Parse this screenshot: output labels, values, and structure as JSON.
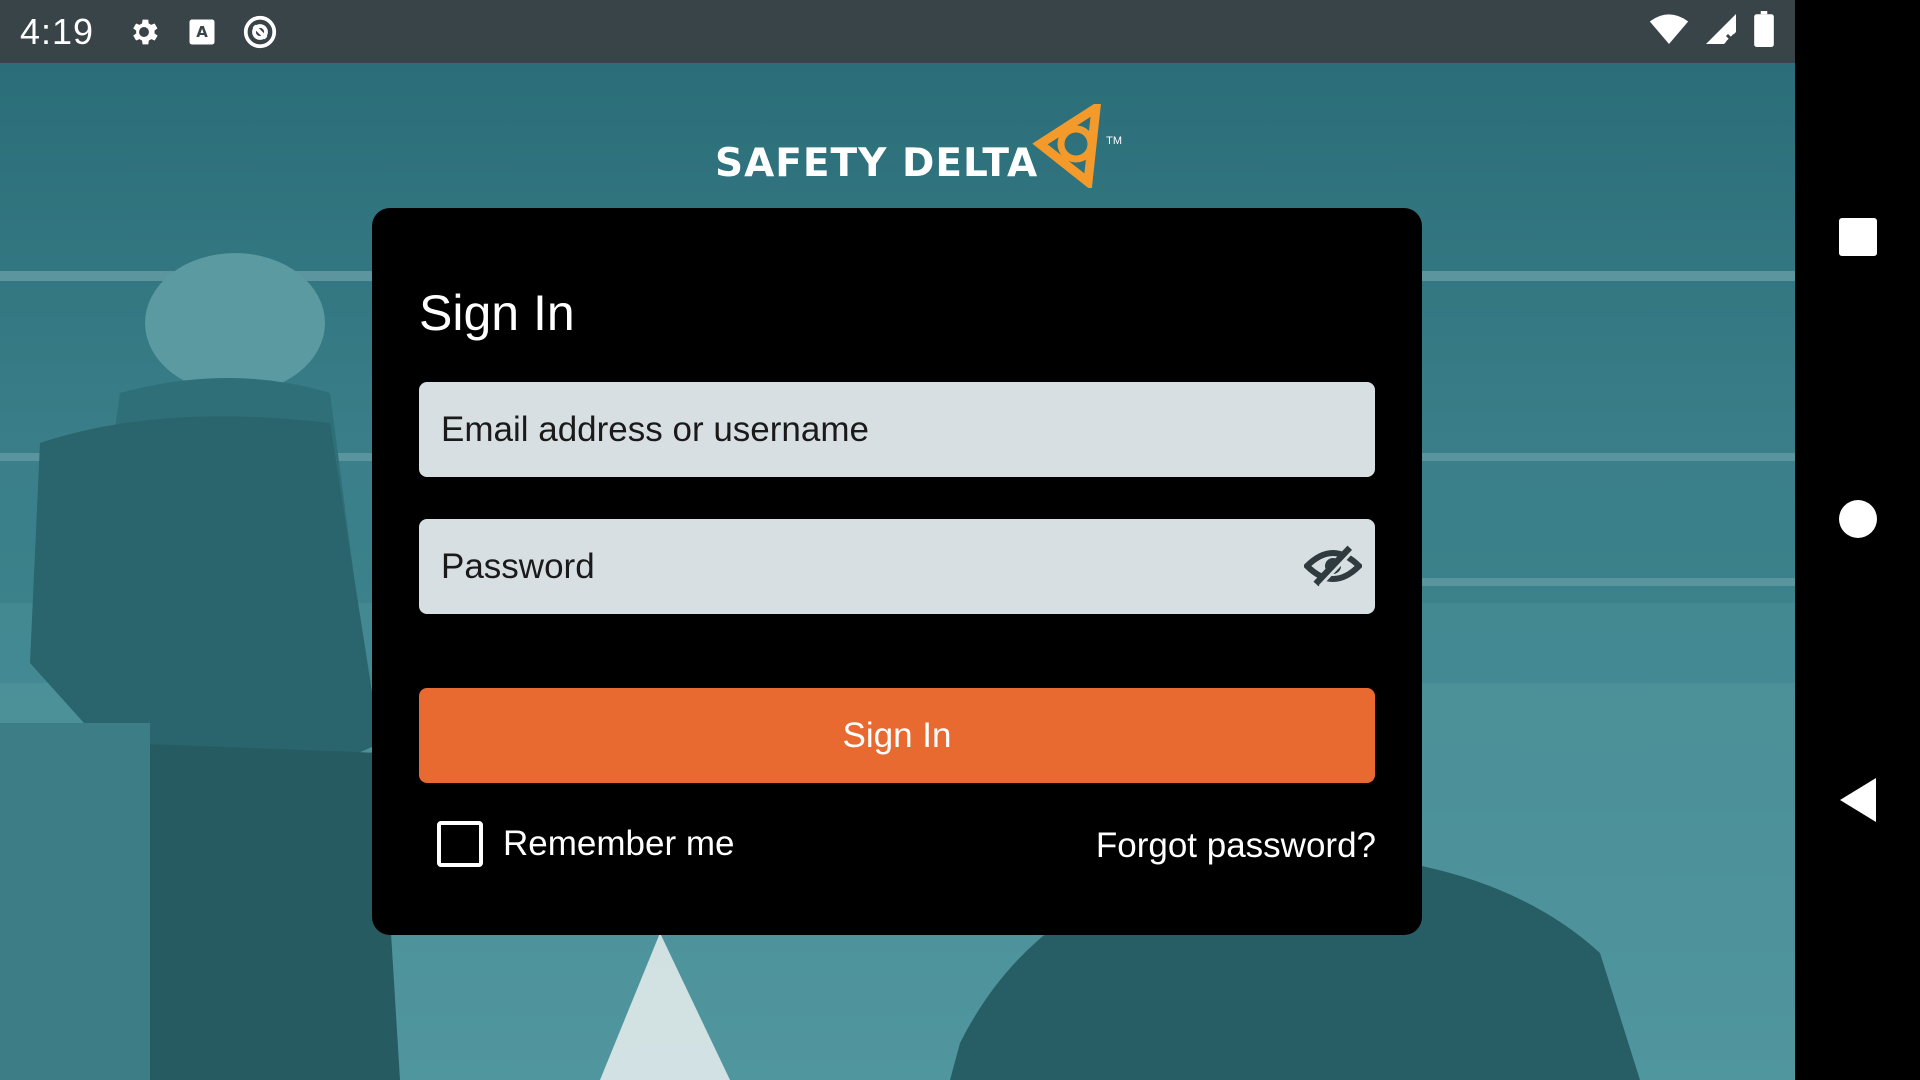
{
  "status_bar": {
    "time": "4:19",
    "left_icons": [
      "settings-icon",
      "keyboard-a-icon",
      "at-sign-icon"
    ],
    "right_icons": [
      "wifi-icon",
      "signal-icon",
      "battery-icon"
    ]
  },
  "logo": {
    "text": "SAFETY DELTA",
    "trademark": "TM",
    "colors": {
      "text": "#ffffff",
      "mark": "#f39a2b"
    }
  },
  "signin_card": {
    "title": "Sign In",
    "email_placeholder": "Email address or username",
    "password_placeholder": "Password",
    "password_toggle_icon": "eye-off-icon",
    "submit_label": "Sign In",
    "remember_label": "Remember me",
    "remember_checked": false,
    "forgot_label": "Forgot password?"
  },
  "nav_bar": {
    "buttons": [
      "recents-square-icon",
      "home-circle-icon",
      "back-triangle-icon"
    ]
  },
  "theme": {
    "accent": "#e86a30",
    "field_bg": "#d8dfe2",
    "card_bg": "#000000",
    "status_bg": "#394448",
    "background_tint": "#3a7f89"
  }
}
